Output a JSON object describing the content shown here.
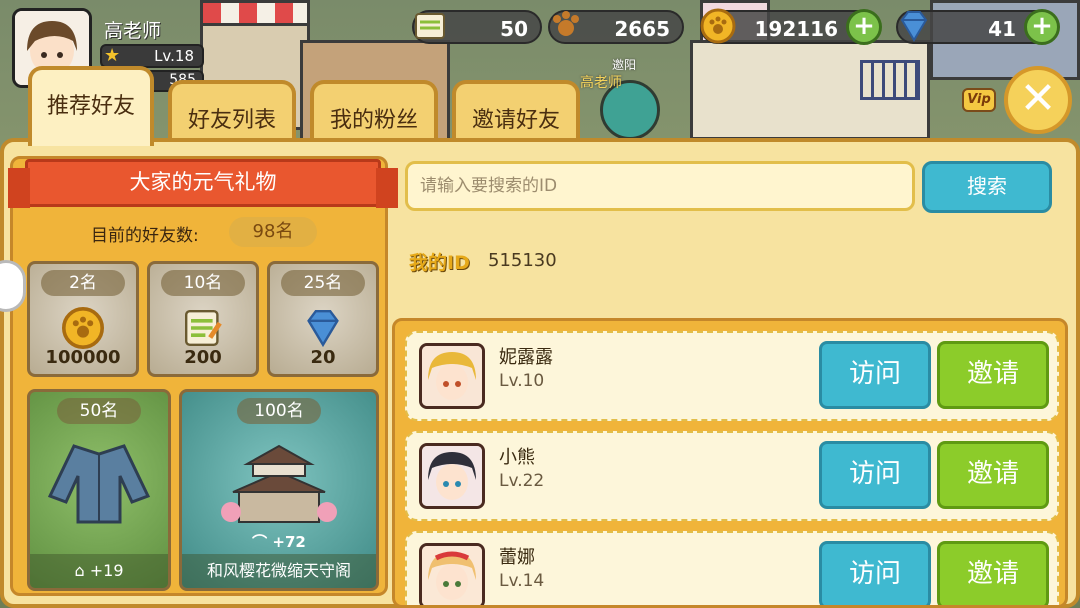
{
  "player": {
    "name": "高老师",
    "level": "Lv.18",
    "exp": "585"
  },
  "currencies": {
    "tickets": "50",
    "paws": "2665",
    "coins": "192116",
    "gems": "41"
  },
  "scene": {
    "npc_name": "高老师",
    "npc_flag": "邀阳",
    "vip": "Vip"
  },
  "tabs": [
    {
      "label": "推荐好友",
      "active": true
    },
    {
      "label": "好友列表",
      "active": false
    },
    {
      "label": "我的粉丝",
      "active": false
    },
    {
      "label": "邀请好友",
      "active": false
    }
  ],
  "gift": {
    "title": "大家的元气礼物",
    "friends_label": "目前的好友数:",
    "friends_count": "98名",
    "rewards": [
      {
        "tier": "2名",
        "icon": "paw-coin-icon",
        "value": "100000"
      },
      {
        "tier": "10名",
        "icon": "ticket-icon",
        "value": "200"
      },
      {
        "tier": "25名",
        "icon": "gem-icon",
        "value": "20"
      },
      {
        "tier": "50名",
        "icon": "jacket-icon",
        "bonus": "+19"
      },
      {
        "tier": "100名",
        "icon": "castle-icon",
        "bonus": "+72",
        "name": "和风樱花微缩天守阁"
      }
    ]
  },
  "search": {
    "placeholder": "请输入要搜索的ID",
    "button": "搜索"
  },
  "my_id": {
    "label": "我的ID",
    "value": "515130"
  },
  "friends": [
    {
      "name": "妮露露",
      "level": "Lv.10",
      "visit": "访问",
      "invite": "邀请"
    },
    {
      "name": "小熊",
      "level": "Lv.22",
      "visit": "访问",
      "invite": "邀请"
    },
    {
      "name": "蕾娜",
      "level": "Lv.14",
      "visit": "访问",
      "invite": "邀请"
    }
  ],
  "colors": {
    "panel": "#f7e3a0",
    "accent_orange": "#f0b43a",
    "visit": "#3fb9d0",
    "invite": "#8ccc2a"
  }
}
